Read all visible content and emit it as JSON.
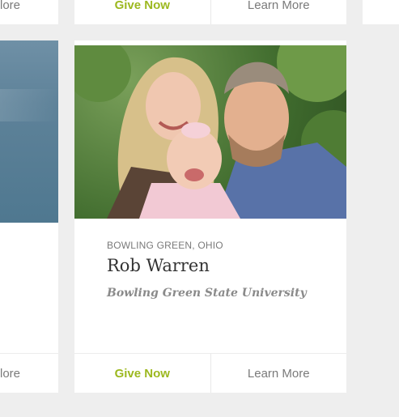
{
  "top_row": {
    "left_learn": "lore",
    "mid_give": "Give Now",
    "mid_learn": "Learn More"
  },
  "left_card": {
    "learn": "lore"
  },
  "profile": {
    "location": "BOWLING GREEN, OHIO",
    "name": "Rob Warren",
    "school": "Bowling Green State University",
    "give_label": "Give Now",
    "learn_label": "Learn More",
    "photo_alt": "family-photo"
  },
  "colors": {
    "accent": "#9cb81f",
    "muted": "#7a7a7a",
    "background": "#eeeeee"
  }
}
